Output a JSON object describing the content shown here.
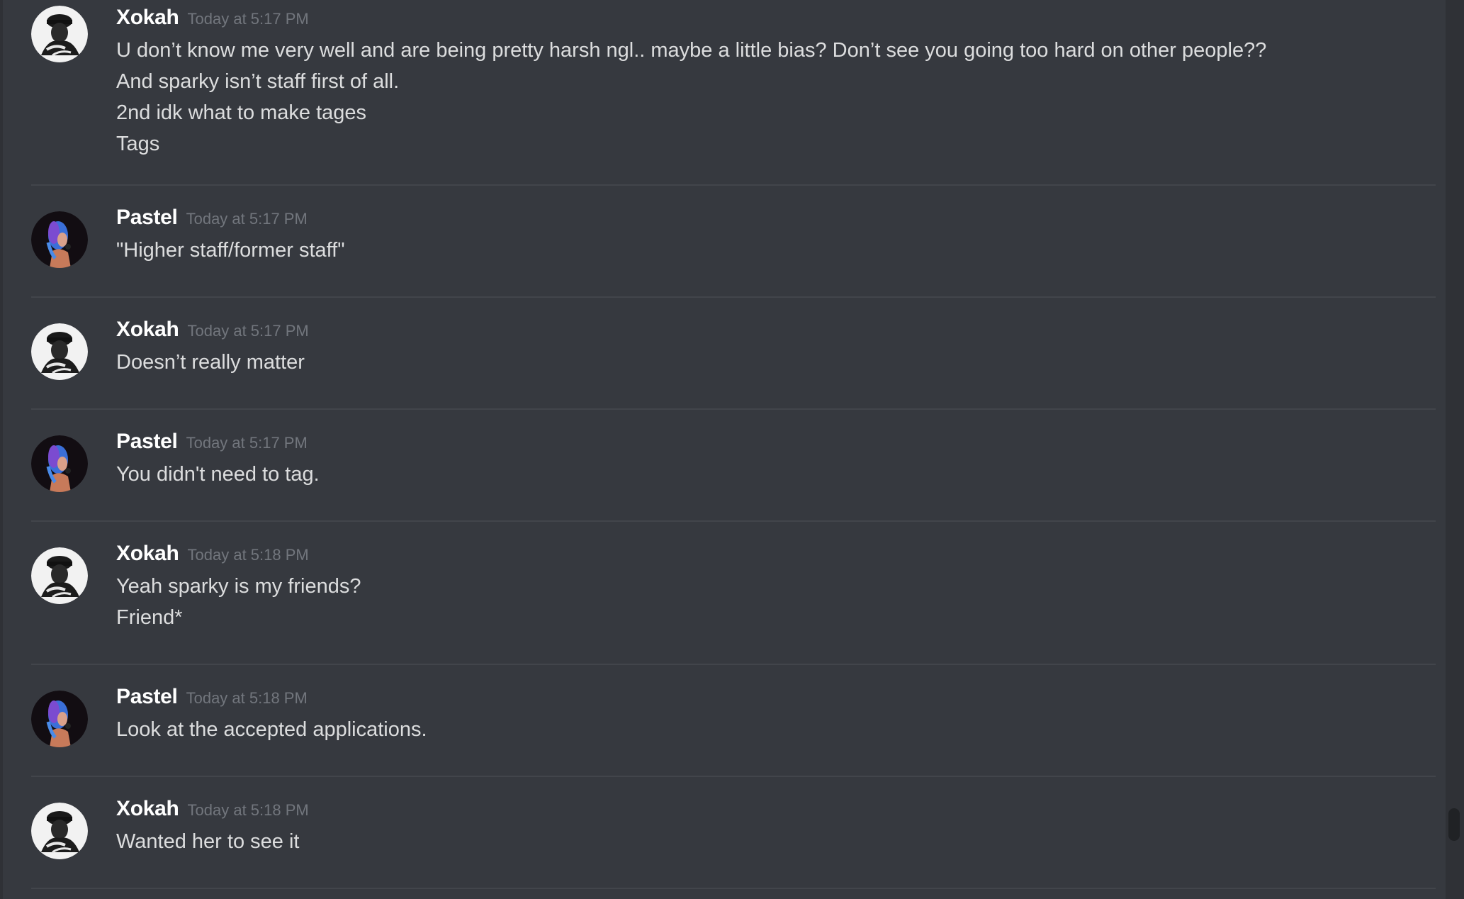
{
  "messages": [
    {
      "author": "Xokah",
      "avatar_icon": "xokah-avatar-icon",
      "timestamp": "Today at 5:17 PM",
      "lines": [
        "U don’t know me very well and are being pretty harsh ngl.. maybe a little bias? Don’t see you going too hard on other people??",
        "And sparky isn’t staff first of all.",
        "2nd idk what to make tages",
        "Tags"
      ]
    },
    {
      "author": "Pastel",
      "avatar_icon": "pastel-avatar-icon",
      "timestamp": "Today at 5:17 PM",
      "lines": [
        "\"Higher staff/former staff\""
      ]
    },
    {
      "author": "Xokah",
      "avatar_icon": "xokah-avatar-icon",
      "timestamp": "Today at 5:17 PM",
      "lines": [
        "Doesn’t really matter"
      ]
    },
    {
      "author": "Pastel",
      "avatar_icon": "pastel-avatar-icon",
      "timestamp": "Today at 5:17 PM",
      "lines": [
        "You didn't need to tag."
      ]
    },
    {
      "author": "Xokah",
      "avatar_icon": "xokah-avatar-icon",
      "timestamp": "Today at 5:18 PM",
      "lines": [
        "Yeah sparky is my friends?",
        "Friend*"
      ]
    },
    {
      "author": "Pastel",
      "avatar_icon": "pastel-avatar-icon",
      "timestamp": "Today at 5:18 PM",
      "lines": [
        "Look at the accepted applications."
      ]
    },
    {
      "author": "Xokah",
      "avatar_icon": "xokah-avatar-icon",
      "timestamp": "Today at 5:18 PM",
      "lines": [
        "Wanted her to see it"
      ]
    }
  ],
  "colors": {
    "background": "#36393f",
    "username": "#ffffff",
    "timestamp": "#72767d",
    "message_text": "#dcddde",
    "divider": "#42454b"
  }
}
